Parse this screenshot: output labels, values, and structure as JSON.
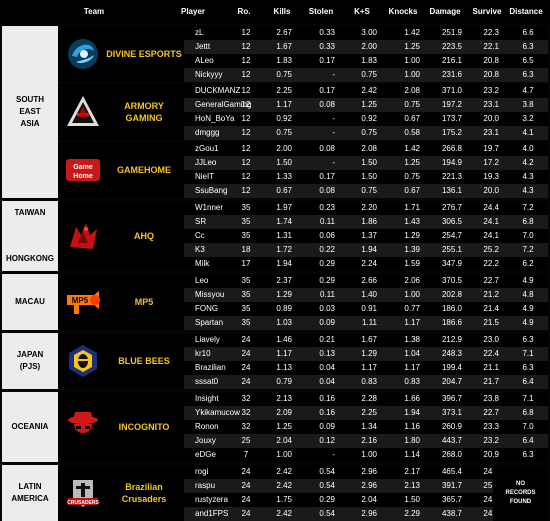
{
  "headers": {
    "team": "Team",
    "player": "Player",
    "rounds": "Ro.",
    "kills": "Kills",
    "stolen": "Stolen",
    "ks": "K+S",
    "knocks": "Knocks",
    "damage": "Damage",
    "survive": "Survive",
    "distance": "Distance"
  },
  "groups": [
    {
      "region_lines": [
        "SOUTH",
        "EAST",
        "ASIA"
      ],
      "teams": [
        {
          "name": "DIVINE ESPORTS",
          "logo": "divine-esports-logo",
          "players": [
            [
              "zL",
              "12",
              "2.67",
              "0.33",
              "3.00",
              "1.42",
              "251.9",
              "22.3",
              "6.6"
            ],
            [
              "Jettt",
              "12",
              "1.67",
              "0.33",
              "2.00",
              "1.25",
              "223.5",
              "22.1",
              "6.3"
            ],
            [
              "ALeo",
              "12",
              "1.83",
              "0.17",
              "1.83",
              "1.00",
              "216.1",
              "20.8",
              "6.5"
            ],
            [
              "Nickyyy",
              "12",
              "0.75",
              "-",
              "0.75",
              "1.00",
              "231.6",
              "20.8",
              "6.3"
            ]
          ]
        },
        {
          "name": "ARMORY GAMING",
          "logo": "armory-gaming-logo",
          "players": [
            [
              "DUCKMANZ",
              "12",
              "2.25",
              "0.17",
              "2.42",
              "2.08",
              "371.0",
              "23.2",
              "4.7"
            ],
            [
              "GeneralGaming",
              "12",
              "1.17",
              "0.08",
              "1.25",
              "0.75",
              "197.2",
              "23.1",
              "3.8"
            ],
            [
              "HoN_BoYa",
              "12",
              "0.92",
              "-",
              "0.92",
              "0.67",
              "173.7",
              "20.0",
              "3.2"
            ],
            [
              "dmggg",
              "12",
              "0.75",
              "-",
              "0.75",
              "0.58",
              "175.2",
              "23.1",
              "4.1"
            ]
          ]
        },
        {
          "name": "GAMEHOME",
          "logo": "gamehome-logo",
          "players": [
            [
              "zGou1",
              "12",
              "2.00",
              "0.08",
              "2.08",
              "1.42",
              "266.8",
              "19.7",
              "4.0"
            ],
            [
              "JJLeo",
              "12",
              "1.50",
              "-",
              "1.50",
              "1.25",
              "194.9",
              "17.2",
              "4.2"
            ],
            [
              "NieIT",
              "12",
              "1.33",
              "0.17",
              "1.50",
              "0.75",
              "221.3",
              "19.3",
              "4.3"
            ],
            [
              "SsuBang",
              "12",
              "0.67",
              "0.08",
              "0.75",
              "0.67",
              "136.1",
              "20.0",
              "4.3"
            ]
          ]
        }
      ]
    },
    {
      "region_lines": [
        "TAIWAN",
        "",
        "HONGKONG"
      ],
      "teams": [
        {
          "name": "AHQ",
          "logo": "ahq-logo",
          "players": [
            [
              "W1nner",
              "35",
              "1.97",
              "0.23",
              "2.20",
              "1.71",
              "276.7",
              "24.4",
              "7.2"
            ],
            [
              "SR",
              "35",
              "1.74",
              "0.11",
              "1.86",
              "1.43",
              "306.5",
              "24.1",
              "6.8"
            ],
            [
              "Cc",
              "35",
              "1.31",
              "0.06",
              "1.37",
              "1.29",
              "254.7",
              "24.1",
              "7.0"
            ],
            [
              "K3",
              "18",
              "1.72",
              "0.22",
              "1.94",
              "1.39",
              "255.1",
              "25.2",
              "7.2"
            ],
            [
              "Milk",
              "17",
              "1.94",
              "0.29",
              "2.24",
              "1.59",
              "347.9",
              "22.2",
              "6.2"
            ]
          ]
        }
      ]
    },
    {
      "region_lines": [
        "MACAU"
      ],
      "teams": [
        {
          "name": "MP5",
          "logo": "mp5-logo",
          "players": [
            [
              "Leo",
              "35",
              "2.37",
              "0.29",
              "2.66",
              "2.06",
              "370.5",
              "22.7",
              "4.9"
            ],
            [
              "Missyou",
              "35",
              "1.29",
              "0.11",
              "1.40",
              "1.00",
              "202.8",
              "21.2",
              "4.8"
            ],
            [
              "FONG",
              "35",
              "0.89",
              "0.03",
              "0.91",
              "0.77",
              "186.0",
              "21.4",
              "4.9"
            ],
            [
              "Spartan",
              "35",
              "1.03",
              "0.09",
              "1.11",
              "1.17",
              "186.6",
              "21.5",
              "4.9"
            ]
          ]
        }
      ]
    },
    {
      "region_lines": [
        "JAPAN",
        "(PJS)"
      ],
      "teams": [
        {
          "name": "BLUE BEES",
          "logo": "blue-bees-logo",
          "players": [
            [
              "Liavely",
              "24",
              "1.46",
              "0.21",
              "1.67",
              "1.38",
              "212.9",
              "23.0",
              "6.3"
            ],
            [
              "kr10",
              "24",
              "1.17",
              "0.13",
              "1.29",
              "1.04",
              "248.3",
              "22.4",
              "7.1"
            ],
            [
              "Brazilian",
              "24",
              "1.13",
              "0.04",
              "1.17",
              "1.17",
              "199.4",
              "21.1",
              "6.3"
            ],
            [
              "sssat0",
              "24",
              "0.79",
              "0.04",
              "0.83",
              "0.83",
              "204.7",
              "21.7",
              "6.4"
            ]
          ]
        }
      ]
    },
    {
      "region_lines": [
        "OCEANIA"
      ],
      "teams": [
        {
          "name": "INCOGNITO",
          "logo": "incognito-logo",
          "players": [
            [
              "Insight",
              "32",
              "2.13",
              "0.16",
              "2.28",
              "1.66",
              "396.7",
              "23.8",
              "7.1"
            ],
            [
              "Ykikamucow",
              "32",
              "2.09",
              "0.16",
              "2.25",
              "1.94",
              "373.1",
              "22.7",
              "6.8"
            ],
            [
              "Ronon",
              "32",
              "1.25",
              "0.09",
              "1.34",
              "1.16",
              "260.9",
              "23.3",
              "7.0"
            ],
            [
              "Jouxy",
              "25",
              "2.04",
              "0.12",
              "2.16",
              "1.80",
              "443.7",
              "23.2",
              "6.4"
            ],
            [
              "eDGe",
              "7",
              "1.00",
              "-",
              "1.00",
              "1.14",
              "268.0",
              "20.9",
              "6.3"
            ]
          ]
        }
      ]
    },
    {
      "region_lines": [
        "LATIN",
        "AMERICA"
      ],
      "no_records": [
        "NO",
        "RECORDS",
        "FOUND"
      ],
      "teams": [
        {
          "name": "Brazilian Crusaders",
          "logo": "brazilian-crusaders-logo",
          "players": [
            [
              "rogi",
              "24",
              "2.42",
              "0.54",
              "2.96",
              "2.17",
              "465.4",
              "24.6",
              ""
            ],
            [
              "raspu",
              "24",
              "2.42",
              "0.54",
              "2.96",
              "2.13",
              "391.7",
              "25.8",
              ""
            ],
            [
              "rustyzera",
              "24",
              "1.75",
              "0.29",
              "2.04",
              "1.50",
              "365.7",
              "24.0",
              ""
            ],
            [
              "and1FPS",
              "24",
              "2.42",
              "0.54",
              "2.96",
              "2.29",
              "438.7",
              "24.6",
              ""
            ]
          ]
        }
      ]
    }
  ]
}
